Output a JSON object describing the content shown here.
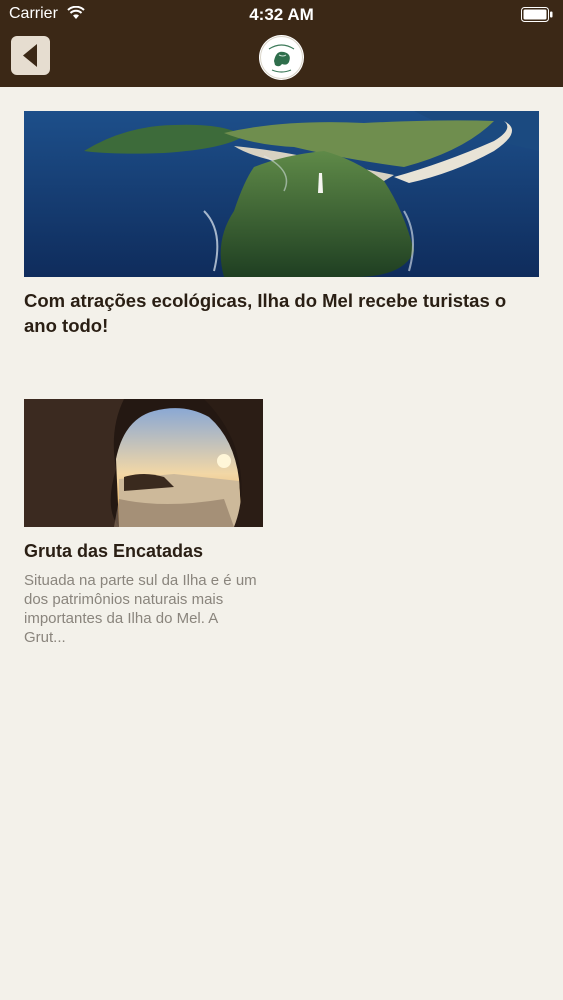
{
  "status_bar": {
    "carrier": "Carrier",
    "time": "4:32 AM"
  },
  "header": {
    "back_icon": "chevron-left-icon",
    "logo": "brand-logo-icon",
    "colors": {
      "background": "#3b2816",
      "back_button": "#e6ddd0"
    }
  },
  "featured": {
    "title": "Com atrações ecológicas, Ilha do Mel recebe turistas o ano todo!"
  },
  "articles": [
    {
      "title": "Gruta das Encatadas",
      "description": "Situada na parte sul da Ilha e é um dos patrimônios naturais mais importantes da Ilha do Mel. A Grut..."
    }
  ],
  "colors": {
    "page_background": "#f3f1ea",
    "title_text": "#2a1f14",
    "description_text": "#8a857d"
  }
}
